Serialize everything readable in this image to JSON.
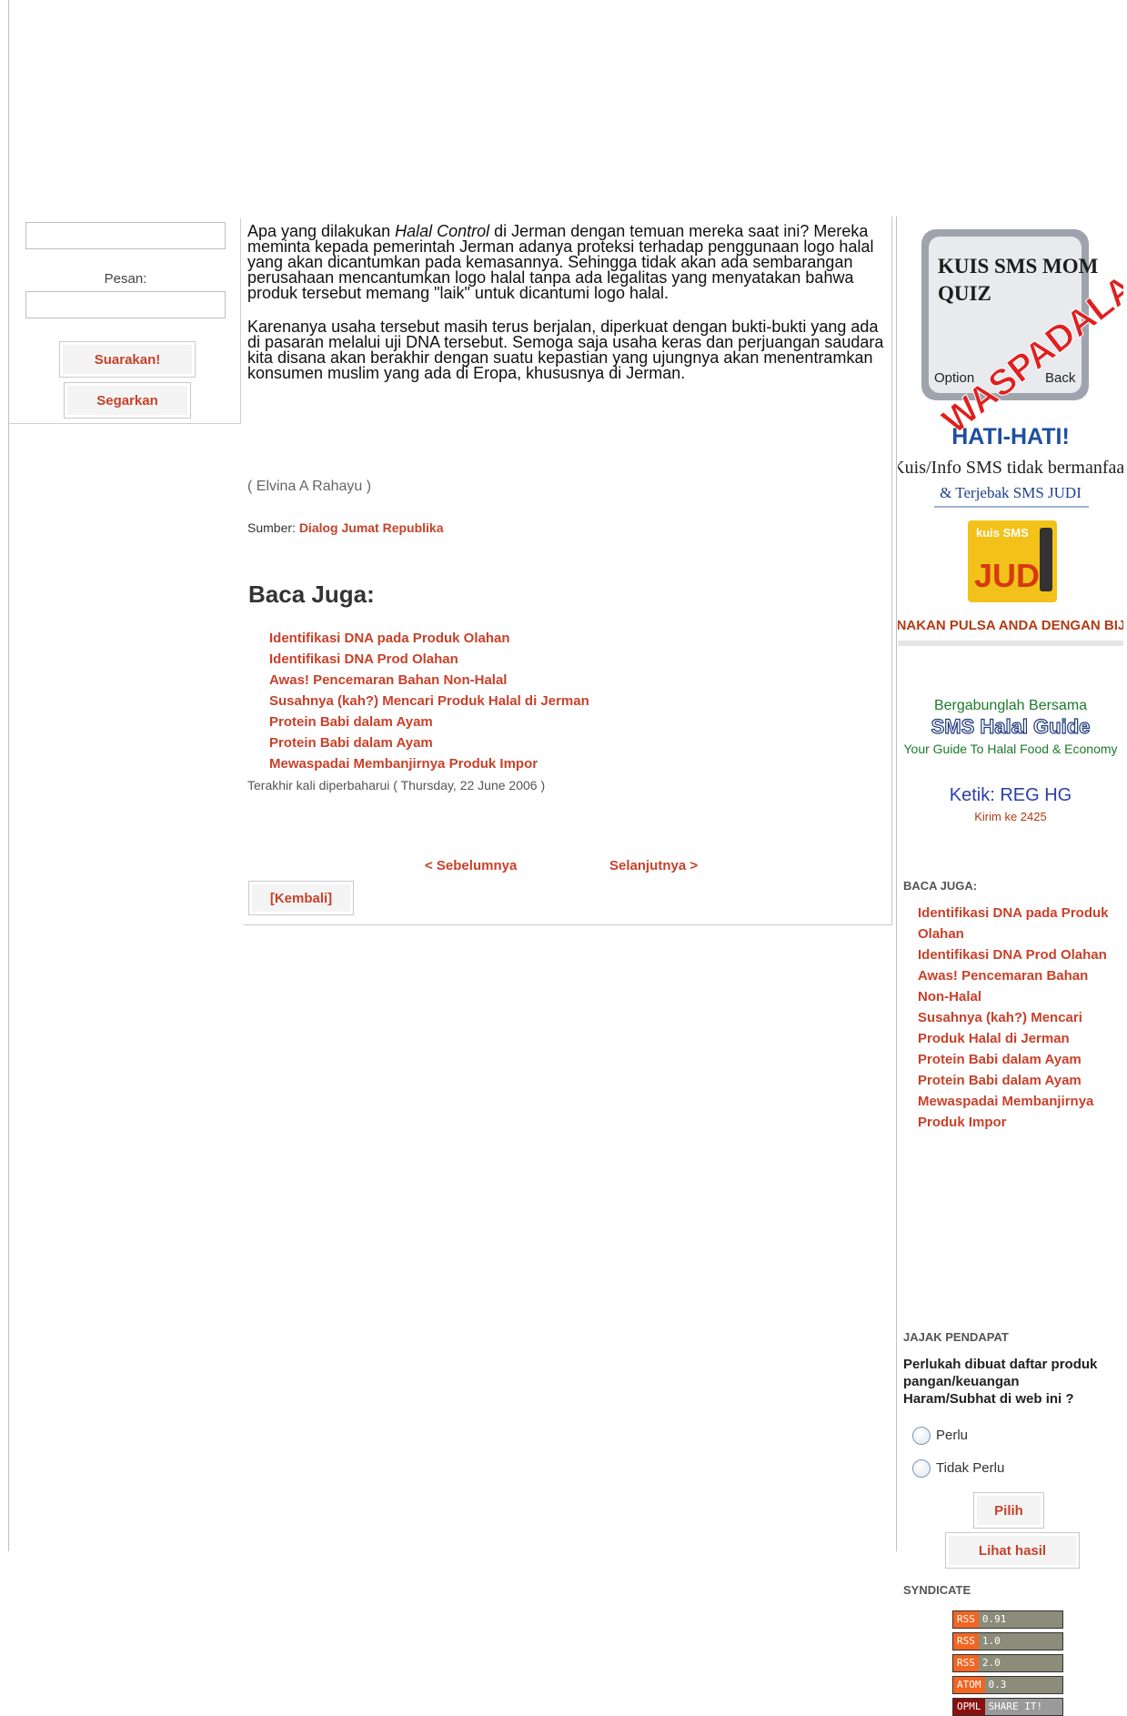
{
  "left_form": {
    "pesan_label": "Pesan:",
    "submit_label": "Suarakan!",
    "refresh_label": "Segarkan"
  },
  "article": {
    "paragraph1_pre": "Apa yang dilakukan ",
    "paragraph1_em": "Halal Control",
    "paragraph1_post": " di Jerman dengan temuan mereka saat ini? Mereka meminta kepada pemerintah Jerman adanya proteksi terhadap penggunaan logo halal yang akan dicantumkan pada kemasannya. Sehingga tidak akan ada sembarangan perusahaan mencantumkan logo halal tanpa ada legalitas yang menyatakan bahwa produk tersebut memang \"laik\" untuk dicantumi logo halal.",
    "paragraph2": "Karenanya usaha tersebut masih terus berjalan, diperkuat dengan bukti-bukti yang ada di pasaran melalui uji DNA tersebut. Semoga saja usaha keras dan perjuangan saudara kita disana akan berakhir dengan suatu kepastian yang ujungnya akan menentramkan konsumen muslim yang ada di Eropa, khususnya di Jerman.",
    "author": "( Elvina A Rahayu )",
    "sumber_label": "Sumber: ",
    "sumber_link": "Dialog Jumat Republika",
    "baca_juga_heading": "Baca Juga:",
    "related": [
      "Identifikasi DNA pada Produk Olahan",
      "Identifikasi DNA Prod Olahan",
      "Awas! Pencemaran Bahan Non-Halal",
      "Susahnya (kah?) Mencari Produk Halal di Jerman",
      "Protein Babi dalam Ayam",
      "Protein Babi dalam Ayam",
      "Mewaspadai Membanjirnya Produk Impor"
    ],
    "updated": "Terakhir kali diperbaharui ( Thursday, 22 June 2006 )",
    "prev_label": "< Sebelumnya",
    "next_label": "Selanjutnya >",
    "back_label": "[Kembali]"
  },
  "ad": {
    "phone_line1": "KUIS SMS MOM",
    "phone_line2": "QUIZ",
    "stamp": "WASPADALAH!",
    "option": "Option",
    "back": "Back",
    "hati": "HATI-HATI!",
    "line1": "Kuis/Info SMS tidak bermanfaat",
    "line2": "& Terjebak SMS JUDI",
    "judi_small": "kuis SMS",
    "judi": "JUDI",
    "pulsa": "GUNAKAN PULSA ANDA DENGAN BIJAK",
    "bergabung": "Bergabunglah Bersama",
    "sms_halal": "SMS Halal Guide",
    "guide": "Your Guide To Halal Food & Economy",
    "ketik": "Ketik: REG HG",
    "kirim": "Kirim ke 2425"
  },
  "right": {
    "baca_juga_title": "BACA JUGA:",
    "related": [
      "Identifikasi DNA pada Produk Olahan",
      "Identifikasi DNA Prod Olahan",
      "Awas! Pencemaran Bahan Non-Halal",
      "Susahnya (kah?) Mencari Produk Halal di Jerman",
      "Protein Babi dalam Ayam",
      "Protein Babi dalam Ayam",
      "Mewaspadai Membanjirnya Produk Impor"
    ],
    "poll_title": "JAJAK PENDAPAT",
    "poll_question": "Perlukah dibuat daftar produk pangan/keuangan Haram/Subhat di web ini ?",
    "poll_options": [
      "Perlu",
      "Tidak Perlu"
    ],
    "vote_label": "Pilih",
    "results_label": "Lihat hasil",
    "syndicate_title": "SYNDICATE",
    "feeds": [
      {
        "tag": "RSS",
        "ver": "0.91"
      },
      {
        "tag": "RSS",
        "ver": "1.0"
      },
      {
        "tag": "RSS",
        "ver": "2.0"
      },
      {
        "tag": "ATOM",
        "ver": "0.3"
      }
    ],
    "opml_tag": "OPML",
    "opml_share": "SHARE IT!"
  }
}
